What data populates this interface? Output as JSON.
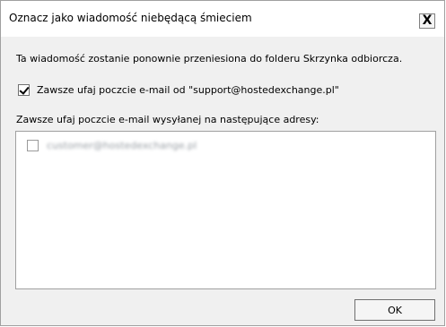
{
  "dialog": {
    "title": "Oznacz jako wiadomość niebędącą śmieciem",
    "close_label": "X",
    "description": "Ta wiadomość zostanie ponownie przeniesiona do folderu Skrzynka odbiorcza.",
    "trust_sender": {
      "label": "Zawsze ufaj poczcie e-mail od \"support@hostedexchange.pl\"",
      "checked": true
    },
    "address_list": {
      "label": "Zawsze ufaj poczcie e-mail wysyłanej na następujące adresy:",
      "items": [
        {
          "email": "customer@hostedexchange.pl",
          "checked": false
        }
      ]
    },
    "ok_label": "OK"
  }
}
